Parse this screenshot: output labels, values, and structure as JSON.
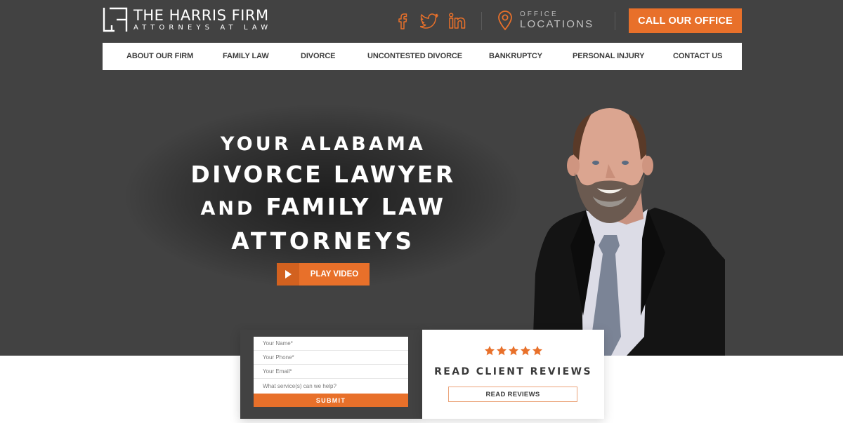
{
  "header": {
    "logo": {
      "title": "THE HARRIS FIRM",
      "subtitle": "ATTORNEYS AT LAW"
    },
    "social": [
      {
        "name": "facebook",
        "icon": "facebook-icon"
      },
      {
        "name": "twitter",
        "icon": "twitter-icon"
      },
      {
        "name": "linkedin",
        "icon": "linkedin-icon"
      }
    ],
    "office": {
      "icon": "map-pin-icon",
      "label_small": "OFFICE",
      "label_big": "LOCATIONS"
    },
    "call_button": "CALL OUR OFFICE"
  },
  "nav": {
    "items": [
      {
        "label": "ABOUT OUR FIRM"
      },
      {
        "label": "FAMILY LAW"
      },
      {
        "label": "DIVORCE"
      },
      {
        "label": "UNCONTESTED DIVORCE"
      },
      {
        "label": "BANKRUPTCY"
      },
      {
        "label": "PERSONAL INJURY"
      },
      {
        "label": "CONTACT US"
      }
    ]
  },
  "hero": {
    "line1": "YOUR ALABAMA",
    "line2": "DIVORCE LAWYER",
    "line3_small": "AND",
    "line3_big": "FAMILY LAW",
    "line4": "ATTORNEYS",
    "play_button": "PLAY VIDEO",
    "portrait_alt": "Attorney portrait"
  },
  "form": {
    "fields": [
      {
        "placeholder": "Your Name*",
        "value": ""
      },
      {
        "placeholder": "Your Phone*",
        "value": ""
      },
      {
        "placeholder": "Your Email*",
        "value": ""
      },
      {
        "placeholder": "What service(s) can we help?",
        "value": ""
      }
    ],
    "submit": "SUBMIT"
  },
  "reviews": {
    "rating": 5,
    "rating_max": 5,
    "title": "READ CLIENT REVIEWS",
    "button": "READ REVIEWS"
  },
  "colors": {
    "accent": "#e8702a",
    "accent_dark": "#d2611f",
    "hero_bg": "#424242",
    "nav_text": "#3d3d3d"
  }
}
